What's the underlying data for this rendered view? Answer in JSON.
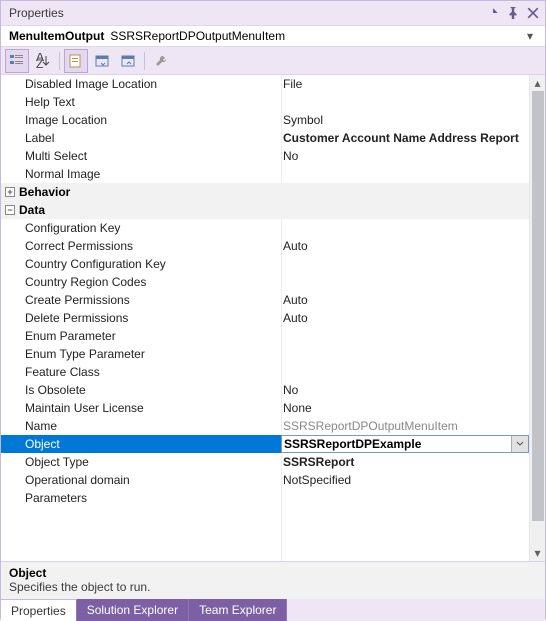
{
  "title": "Properties",
  "object_bar": {
    "type": "MenuItemOutput",
    "name": "SSRSReportDPOutputMenuItem"
  },
  "categories": [
    {
      "name": "Behavior",
      "expanded": true,
      "plus": "+"
    },
    {
      "name": "Data",
      "expanded": true,
      "plus": "−"
    }
  ],
  "props_top": [
    {
      "label": "Disabled Image Location",
      "value": "File"
    },
    {
      "label": "Help Text",
      "value": ""
    },
    {
      "label": "Image Location",
      "value": "Symbol"
    },
    {
      "label": "Label",
      "value": "Customer Account Name Address Report",
      "bold": true
    },
    {
      "label": "Multi Select",
      "value": "No"
    },
    {
      "label": "Normal Image",
      "value": ""
    }
  ],
  "props_data": [
    {
      "label": "Configuration Key",
      "value": ""
    },
    {
      "label": "Correct Permissions",
      "value": "Auto"
    },
    {
      "label": "Country Configuration Key",
      "value": ""
    },
    {
      "label": "Country Region Codes",
      "value": ""
    },
    {
      "label": "Create Permissions",
      "value": "Auto"
    },
    {
      "label": "Delete Permissions",
      "value": "Auto"
    },
    {
      "label": "Enum Parameter",
      "value": ""
    },
    {
      "label": "Enum Type Parameter",
      "value": ""
    },
    {
      "label": "Feature Class",
      "value": ""
    },
    {
      "label": "Is Obsolete",
      "value": "No"
    },
    {
      "label": "Maintain User License",
      "value": "None"
    },
    {
      "label": "Name",
      "value": "SSRSReportDPOutputMenuItem",
      "grey": true
    },
    {
      "label": "Object",
      "value": "SSRSReportDPExample",
      "bold": true,
      "selected": true
    },
    {
      "label": "Object Type",
      "value": "SSRSReport",
      "bold": true
    },
    {
      "label": "Operational domain",
      "value": "NotSpecified"
    },
    {
      "label": "Parameters",
      "value": ""
    }
  ],
  "description": {
    "title": "Object",
    "text": "Specifies the object to run."
  },
  "tabs": [
    {
      "label": "Properties",
      "active": true
    },
    {
      "label": "Solution Explorer",
      "active": false
    },
    {
      "label": "Team Explorer",
      "active": false
    }
  ]
}
